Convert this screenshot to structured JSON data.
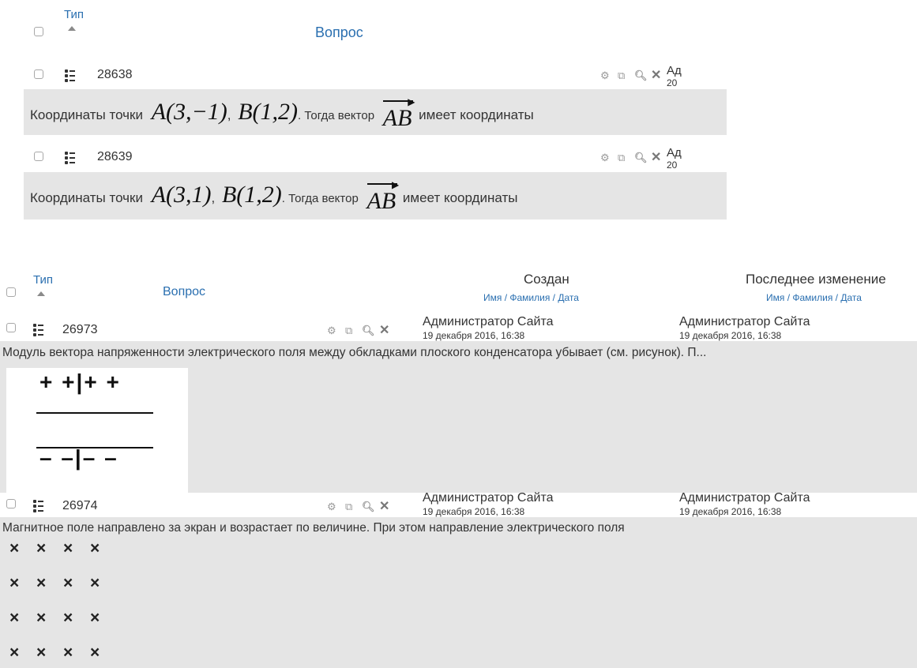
{
  "top_panel": {
    "header": {
      "type_label": "Тип",
      "question_label": "Вопрос"
    },
    "rows": [
      {
        "id": "28638",
        "creator_cut": "Ад",
        "date_cut": "20",
        "text_start": "Координаты точки",
        "point_a": "A(3,−1)",
        "sep1": ",",
        "point_b": "B(1,2)",
        "text_mid": ". Тогда вектор",
        "vector": "AB",
        "text_end": "имеет координаты"
      },
      {
        "id": "28639",
        "creator_cut": "Ад",
        "date_cut": "20",
        "text_start": "Координаты точки",
        "point_a": "A(3,1)",
        "sep1": ",",
        "point_b": "B(1,2)",
        "text_mid": ". Тогда вектор",
        "vector": "AB",
        "text_end": "имеет координаты"
      }
    ]
  },
  "bottom_panel": {
    "header": {
      "type_label": "Тип",
      "question_label": "Вопрос",
      "created_label": "Создан",
      "modified_label": "Последнее изменение",
      "name_sort": "Имя / Фамилия / Дата"
    },
    "rows": [
      {
        "id": "26973",
        "creator": "Администратор Сайта",
        "created": "19 декабря 2016, 16:38",
        "modifier": "Администратор Сайта",
        "modified": "19 декабря 2016, 16:38",
        "text": "Модуль вектора напряженности электрического поля между обкладками плоского конденсатора убывает (см. рисунок). П...",
        "plate_top": "+ +|+ +",
        "plate_bottom": "– –|– –"
      },
      {
        "id": "26974",
        "creator": "Администратор Сайта",
        "created": "19 декабря 2016, 16:38",
        "modifier": "Администратор Сайта",
        "modified": "19 декабря 2016, 16:38",
        "text": "Магнитное поле направлено за экран и возрастает по величине. При этом направление электрического поля",
        "cross_rows": [
          [
            "×",
            "×",
            "×",
            "×"
          ],
          [
            "×",
            "×",
            "×",
            "×"
          ],
          [
            "×",
            "×",
            "×",
            "×"
          ],
          [
            "×",
            "×",
            "×",
            "×"
          ]
        ]
      }
    ]
  },
  "icons": [
    "checkbox-icon",
    "multichoice-icon",
    "gear-icon",
    "duplicate-icon",
    "preview-icon",
    "delete-icon",
    "sort-asc-icon"
  ],
  "colors": {
    "link": "#2a6fb0",
    "row_bg": "#e5e5e5"
  }
}
